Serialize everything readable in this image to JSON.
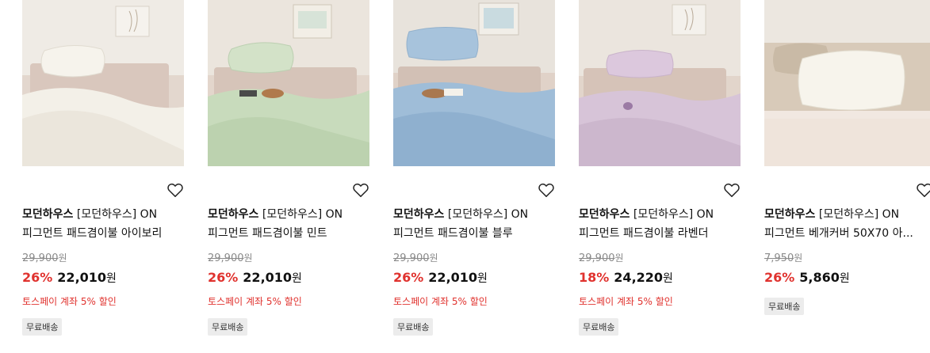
{
  "products": [
    {
      "brand": "모던하우스",
      "name_line1": "[모던하우스] ON",
      "name_line2": "피그먼트 패드겸이불 아이보리",
      "original_price": "29,900",
      "original_unit": "원",
      "discount": "26%",
      "price": "22,010",
      "price_unit": "원",
      "promo": "토스페이 계좌 5% 할인",
      "shipping": "무료배송",
      "color": "#f4f1ea"
    },
    {
      "brand": "모던하우스",
      "name_line1": "[모던하우스] ON",
      "name_line2": "피그먼트 패드겸이불 민트",
      "original_price": "29,900",
      "original_unit": "원",
      "discount": "26%",
      "price": "22,010",
      "price_unit": "원",
      "promo": "토스페이 계좌 5% 할인",
      "shipping": "무료배송",
      "color": "#cfe0c6"
    },
    {
      "brand": "모던하우스",
      "name_line1": "[모던하우스] ON",
      "name_line2": "피그먼트 패드겸이불 블루",
      "original_price": "29,900",
      "original_unit": "원",
      "discount": "26%",
      "price": "22,010",
      "price_unit": "원",
      "promo": "토스페이 계좌 5% 할인",
      "shipping": "무료배송",
      "color": "#a9c4dc"
    },
    {
      "brand": "모던하우스",
      "name_line1": "[모던하우스] ON",
      "name_line2": "피그먼트 패드겸이불 라벤더",
      "original_price": "29,900",
      "original_unit": "원",
      "discount": "18%",
      "price": "24,220",
      "price_unit": "원",
      "promo": "토스페이 계좌 5% 할인",
      "shipping": "무료배송",
      "color": "#dccbe0"
    },
    {
      "brand": "모던하우스",
      "name_line1": "[모던하우스] ON",
      "name_line2": "피그먼트 베개커버 50X70 아...",
      "original_price": "7,950",
      "original_unit": "원",
      "discount": "26%",
      "price": "5,860",
      "price_unit": "원",
      "shipping": "무료배송",
      "color": "#f6f3ec"
    }
  ],
  "colors": {
    "discount_red": "#e0322e",
    "badge_bg": "#ececec"
  },
  "icons": {
    "wishlist": "heart-outline-icon"
  }
}
